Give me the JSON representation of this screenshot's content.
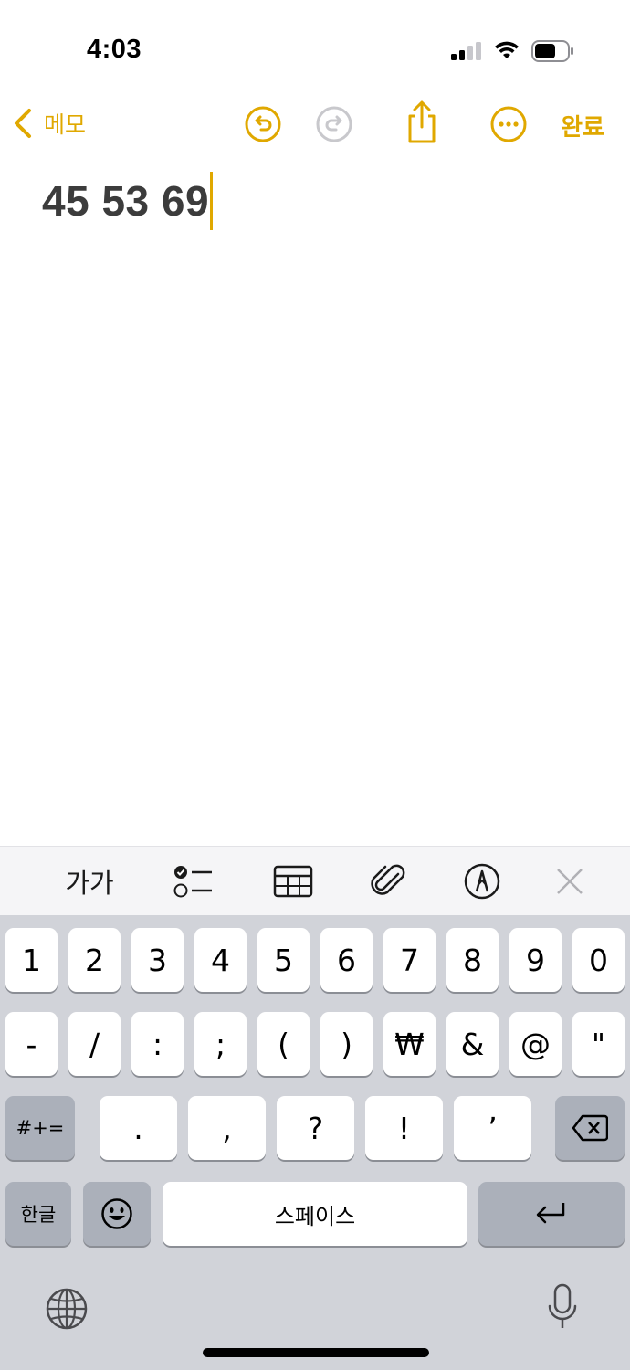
{
  "status_bar": {
    "time": "4:03"
  },
  "nav": {
    "back_label": "메모",
    "done_label": "완료"
  },
  "note": {
    "text": "45 53 69"
  },
  "toolbar": {
    "format_label": "가가"
  },
  "keyboard": {
    "row1": [
      "1",
      "2",
      "3",
      "4",
      "5",
      "6",
      "7",
      "8",
      "9",
      "0"
    ],
    "row2": [
      "-",
      "/",
      ":",
      ";",
      "(",
      ")",
      "₩",
      "&",
      "@",
      "\""
    ],
    "row3_mode": "#+=",
    "row3": [
      ".",
      ",",
      "?",
      "!",
      "’"
    ],
    "lang_key": "한글",
    "space_label": "스페이스"
  },
  "colors": {
    "accent": "#E0A800",
    "keyboard_bg": "#d1d3d9",
    "dark_key": "#abb0ba"
  }
}
